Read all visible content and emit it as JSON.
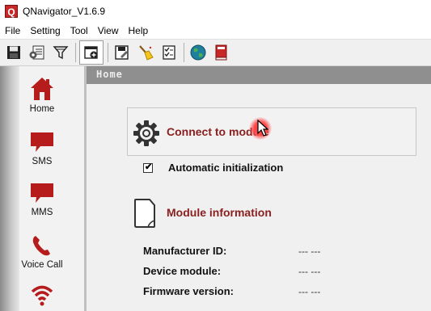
{
  "window": {
    "title": "QNavigator_V1.6.9",
    "app_icon_letter": "Q"
  },
  "menu": [
    "File",
    "Setting",
    "Tool",
    "View",
    "Help"
  ],
  "toolbar": {
    "icons": [
      "save-icon",
      "settings-list-icon",
      "filter-icon",
      "home-tab-icon",
      "save-as-icon",
      "clean-broom-icon",
      "checklist-icon",
      "globe-icon",
      "book-icon"
    ],
    "active": "home-tab-icon"
  },
  "sidebar": {
    "items": [
      {
        "label": "Home",
        "icon": "home-icon"
      },
      {
        "label": "SMS",
        "icon": "sms-icon"
      },
      {
        "label": "MMS",
        "icon": "mms-icon"
      },
      {
        "label": "Voice Call",
        "icon": "phone-icon"
      },
      {
        "label": "",
        "icon": "wifi-icon"
      }
    ]
  },
  "content": {
    "header_title": "Home",
    "connect_label": "Connect to module",
    "auto_init": {
      "label": "Automatic initialization",
      "checked": true
    },
    "module_info_title": "Module information",
    "info_rows": [
      {
        "label": "Manufacturer ID:",
        "value": "--- ---"
      },
      {
        "label": "Device module:",
        "value": "--- ---"
      },
      {
        "label": "Firmware version:",
        "value": "--- ---"
      }
    ]
  },
  "colors": {
    "accent_red": "#8b2020",
    "header_gray": "#8f8f8f"
  }
}
